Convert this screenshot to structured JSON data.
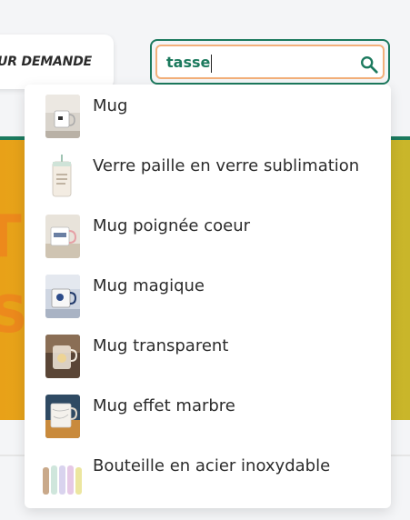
{
  "header": {
    "nav_label": "UR DEMANDE"
  },
  "search": {
    "value": "tasse",
    "placeholder": "",
    "button_icon": "search-icon"
  },
  "banner": {
    "line1": "T'",
    "line2": "S"
  },
  "results": [
    {
      "label": "Mug",
      "icon": "mug-thumbnail"
    },
    {
      "label": "Verre paille en verre sublimation",
      "icon": "glass-thumbnail"
    },
    {
      "label": "Mug poignée coeur",
      "icon": "heart-mug-thumbnail"
    },
    {
      "label": "Mug magique",
      "icon": "magic-mug-thumbnail"
    },
    {
      "label": "Mug transparent",
      "icon": "transparent-mug-thumbnail"
    },
    {
      "label": "Mug effet marbre",
      "icon": "marble-mug-thumbnail"
    },
    {
      "label": "Bouteille en acier inoxydable",
      "icon": "bottle-thumbnail"
    }
  ],
  "colors": {
    "accent_green": "#1c7a5e",
    "search_border_orange": "#f3b07a",
    "banner_yellow": "#d6b125"
  }
}
